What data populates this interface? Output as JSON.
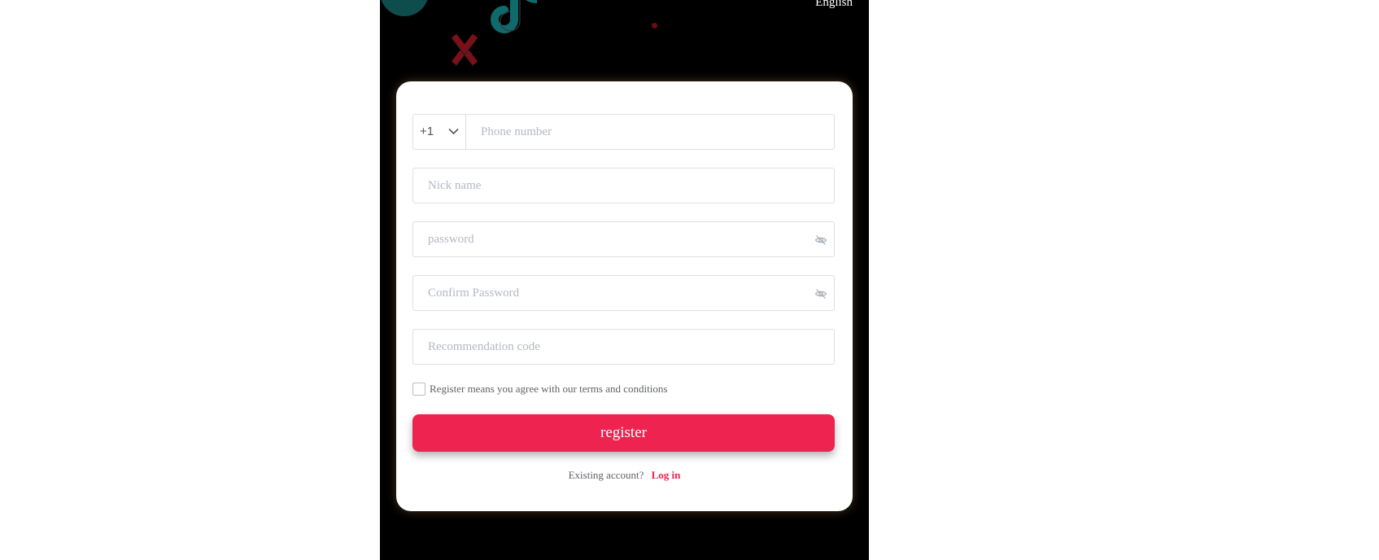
{
  "header": {
    "language_label": "English"
  },
  "form": {
    "country_code": "+1",
    "phone_placeholder": "Phone number",
    "nickname_placeholder": "Nick name",
    "password_placeholder": "password",
    "confirm_password_placeholder": "Confirm Password",
    "recommendation_placeholder": "Recommendation code",
    "agree_text": "Register means you agree with our terms and conditions",
    "agree_checked": false,
    "register_label": "register",
    "existing_account_text": "Existing account?",
    "login_label": "Log in"
  },
  "icons": {
    "country_dropdown": "chevron-down-icon",
    "password_toggle": "eye-off-icon",
    "confirm_password_toggle": "eye-off-icon",
    "background_decorations": [
      "circle",
      "music-note-logo-icon",
      "x-mark-icon",
      "dot"
    ]
  },
  "colors": {
    "background": "#000000",
    "card": "#ffffff",
    "accent": "#ee2350",
    "teal_decoration": "#0f6b6b",
    "red_decoration": "#7a1018",
    "placeholder": "#b4b8c2",
    "border": "#dcdfe6"
  }
}
